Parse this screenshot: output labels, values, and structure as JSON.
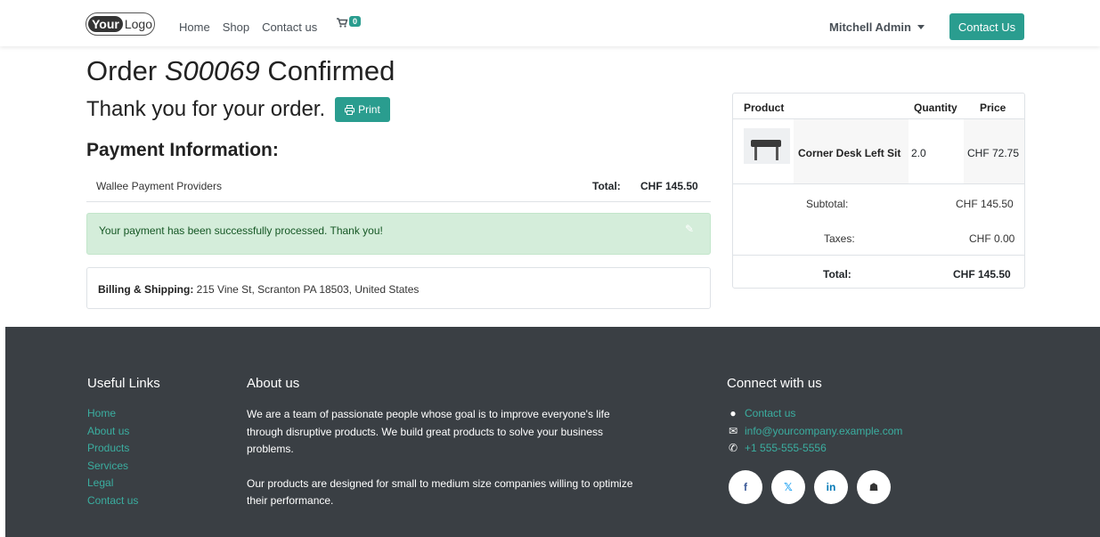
{
  "header": {
    "logo_brand": "Your",
    "logo_text": "Logo",
    "nav": [
      "Home",
      "Shop",
      "Contact us"
    ],
    "cart_count": "0",
    "user_name": "Mitchell Admin",
    "contact_button": "Contact Us"
  },
  "order": {
    "title_prefix": "Order ",
    "order_number": "S00069",
    "title_suffix": " Confirmed",
    "thank_you": "Thank you for your order.",
    "print_label": "Print"
  },
  "payment": {
    "title": "Payment Information:",
    "provider": "Wallee Payment Providers",
    "total_label": "Total:",
    "total_value": "CHF 145.50",
    "success_message": "Your payment has been successfully processed. Thank you!"
  },
  "billing": {
    "label": "Billing & Shipping:",
    "address": "215 Vine St, Scranton PA 18503, United States"
  },
  "summary": {
    "headers": {
      "product": "Product",
      "quantity": "Quantity",
      "price": "Price"
    },
    "item": {
      "name": "Corner Desk Left Sit",
      "quantity": "2.0",
      "price": "CHF 72.75"
    },
    "subtotal_label": "Subtotal:",
    "subtotal_value": "CHF 145.50",
    "taxes_label": "Taxes:",
    "taxes_value": "CHF 0.00",
    "total_label": "Total:",
    "total_value": "CHF 145.50"
  },
  "footer": {
    "useful_links_title": "Useful Links",
    "useful_links": [
      "Home",
      "About us",
      "Products",
      "Services",
      "Legal",
      "Contact us"
    ],
    "about_title": "About us",
    "about_p1": "We are a team of passionate people whose goal is to improve everyone's life through disruptive products. We build great products to solve your business problems.",
    "about_p2": "Our products are designed for small to medium size companies willing to optimize their performance.",
    "connect_title": "Connect with us",
    "contact_link": "Contact us",
    "email": "info@yourcompany.example.com",
    "phone": "+1 555-555-5556",
    "social": [
      "f",
      "𝕏",
      "in",
      "☗"
    ]
  },
  "colors": {
    "accent": "#2a9d8f",
    "footer_bg": "#3a3f44",
    "success_bg": "#d4edda",
    "success_text": "#155724"
  }
}
